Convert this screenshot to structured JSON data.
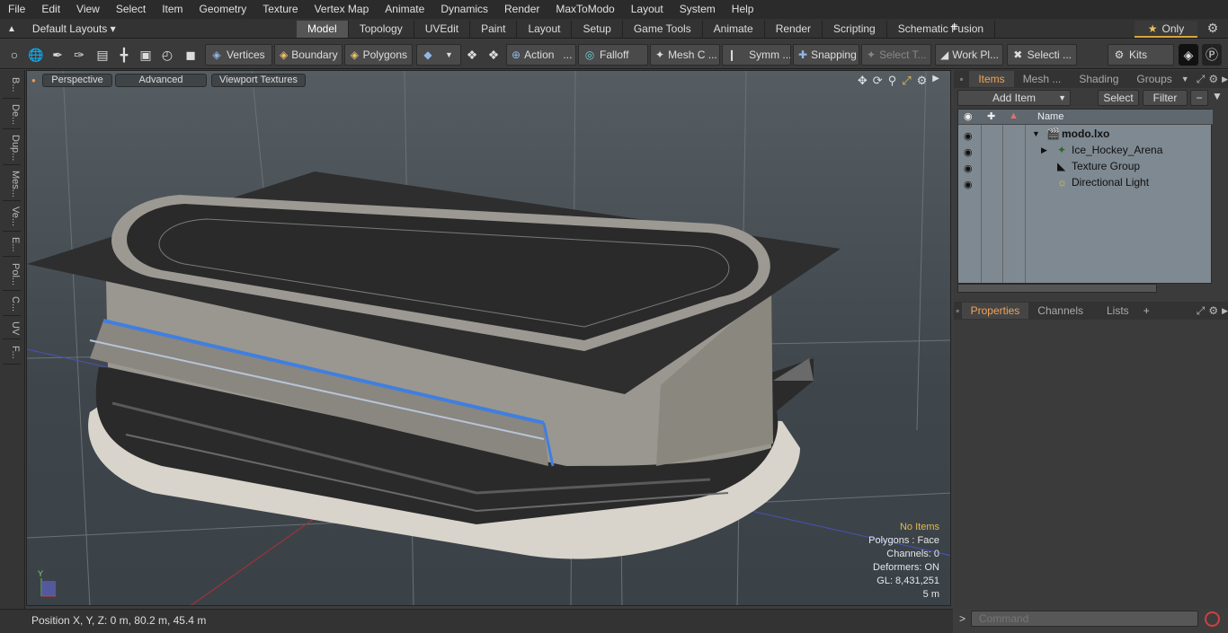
{
  "menu": [
    "File",
    "Edit",
    "View",
    "Select",
    "Item",
    "Geometry",
    "Texture",
    "Vertex Map",
    "Animate",
    "Dynamics",
    "Render",
    "MaxToModo",
    "Layout",
    "System",
    "Help"
  ],
  "layout": {
    "selector": "Default Layouts ▾",
    "tabs": [
      "Model",
      "Topology",
      "UVEdit",
      "Paint",
      "Layout",
      "Setup",
      "Game Tools",
      "Animate",
      "Render",
      "Scripting",
      "Schematic Fusion"
    ],
    "add": "+",
    "only": "Only"
  },
  "toolbar": {
    "vertices": "Vertices",
    "boundary": "Boundary",
    "polygons": "Polygons",
    "action": "Action",
    "action_more": "...",
    "falloff": "Falloff",
    "mesh": "Mesh C ...",
    "symm": "Symm ...",
    "snapping": "Snapping",
    "select_t": "Select T...",
    "work_pl": "Work Pl...",
    "selecti": "Selecti ...",
    "kits": "Kits"
  },
  "left_tabs": [
    "B...",
    "De...",
    "Dup...",
    "Mes...",
    "Ve...",
    "E...",
    "Pol...",
    "C...",
    "UV",
    "F..."
  ],
  "viewport": {
    "perspective": "Perspective",
    "advanced": "Advanced",
    "textures": "Viewport Textures",
    "hud": {
      "no_items": "No Items",
      "polygons": "Polygons : Face",
      "channels": "Channels: 0",
      "deformers": "Deformers: ON",
      "gl": "GL: 8,431,251",
      "scale": "5 m"
    },
    "axis_y": "Y"
  },
  "status": {
    "position": "Position X, Y, Z:   0 m, 80.2 m, 45.4 m"
  },
  "items_panel": {
    "tabs": [
      "Items",
      "Mesh ...",
      "Shading",
      "Groups"
    ],
    "add_item": "Add Item",
    "select": "Select",
    "filter": "Filter",
    "col_name": "Name",
    "rows": [
      {
        "label": "modo.lxo",
        "icon": "scene-icon"
      },
      {
        "label": "Ice_Hockey_Arena",
        "icon": "mesh-item-icon"
      },
      {
        "label": "Texture Group",
        "icon": "texture-group-icon"
      },
      {
        "label": "Directional Light",
        "icon": "light-icon"
      }
    ]
  },
  "properties_panel": {
    "tabs": [
      "Properties",
      "Channels",
      "Lists"
    ],
    "add": "+"
  },
  "command": {
    "placeholder": "Command",
    "prompt": ">"
  },
  "colors": {
    "accent": "#f0a35b",
    "menubar": "#2b2b2b",
    "tree_bg": "#7f8991",
    "selection_blue": "#3f7fe0"
  }
}
